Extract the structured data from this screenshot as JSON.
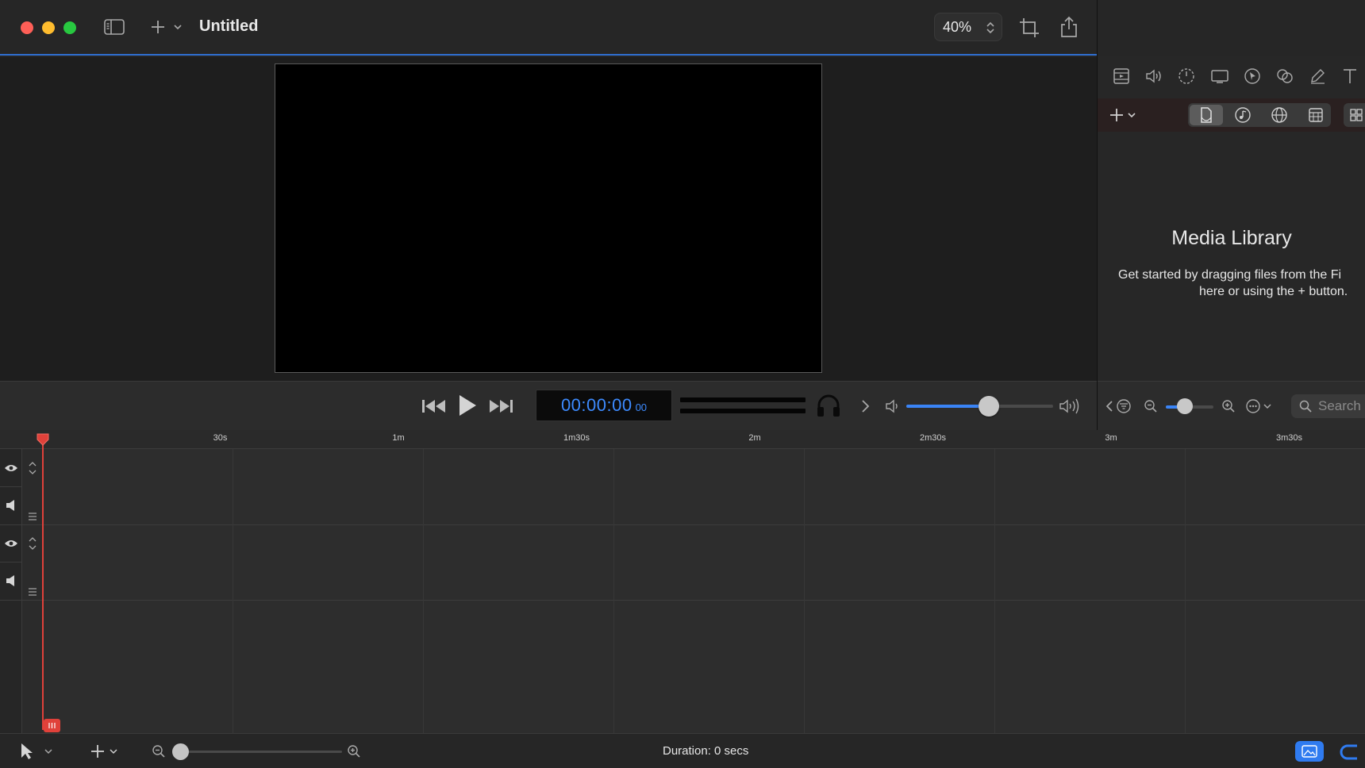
{
  "window": {
    "title": "Untitled",
    "zoom_value": "40%"
  },
  "transport": {
    "timecode": "00:00:00",
    "frames": "00",
    "volume_level": 0.56
  },
  "library": {
    "title": "Media Library",
    "message_line1": "Get started by dragging files from the Fi",
    "message_line2": "here or using the + button.",
    "search_placeholder": "Search",
    "thumb_zoom_level": 0.4
  },
  "ruler": {
    "ticks": [
      "30s",
      "1m",
      "1m30s",
      "2m",
      "2m30s",
      "3m",
      "3m30s"
    ]
  },
  "timeline": {
    "zoom_level": 0.0,
    "duration_label": "Duration: 0 secs"
  },
  "colors": {
    "accent": "#2f7bf0",
    "playhead": "#e0413a",
    "timecode": "#3d8bff"
  },
  "icons": {
    "sidebar_toggle": "sidebar-icon",
    "add": "plus-icon",
    "crop": "crop-icon",
    "share": "share-icon",
    "skip_back": "skip-back-icon",
    "play": "play-icon",
    "skip_forward": "skip-forward-icon",
    "headphones": "headphones-icon",
    "volume_low": "speaker-low-icon",
    "volume_high": "speaker-high-icon"
  }
}
